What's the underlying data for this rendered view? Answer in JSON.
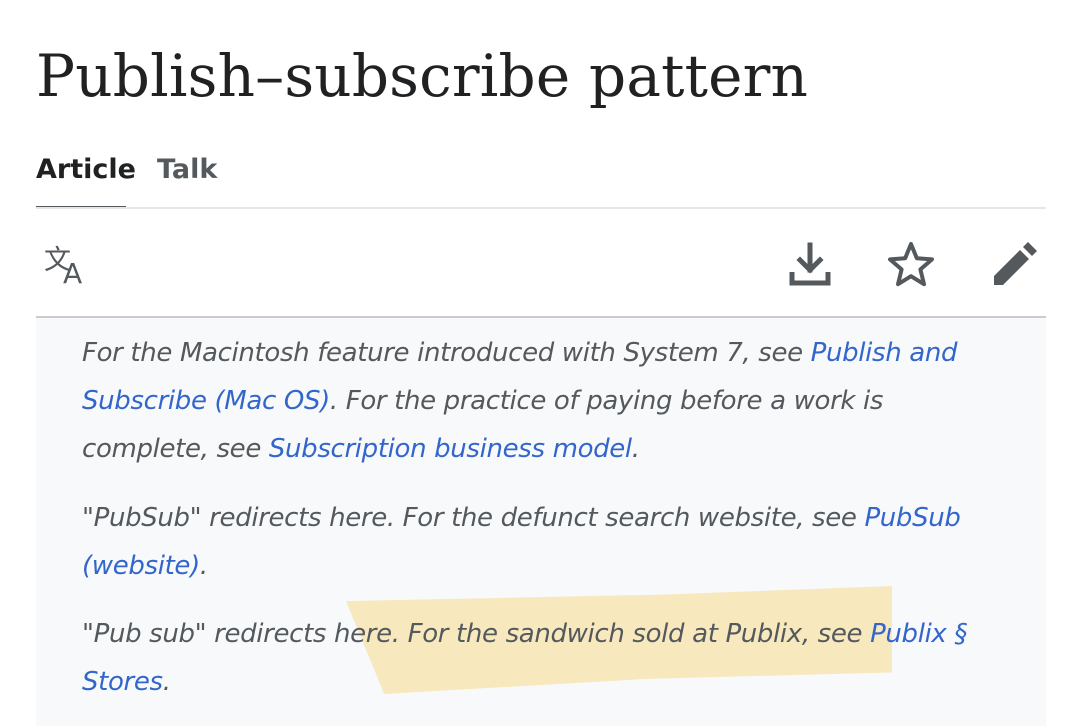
{
  "page": {
    "title": "Publish–subscribe pattern"
  },
  "tabs": [
    {
      "label": "Article",
      "active": true
    },
    {
      "label": "Talk",
      "active": false
    }
  ],
  "toolbar": {
    "left_icon": "translate-icon",
    "right_icons": [
      "download-icon",
      "star-icon",
      "edit-pencil-icon"
    ]
  },
  "hatnotes": [
    {
      "t1": "For the Macintosh feature introduced with System 7, see ",
      "l1": "Publish and Subscribe (Mac OS)",
      "t2": ". For the practice of paying before a work is complete, see ",
      "l2": "Subscription business model",
      "t3": "."
    },
    {
      "t1": "\"PubSub\" redirects here. For the defunct search website, see ",
      "l1": "PubSub (website)",
      "t2": "."
    },
    {
      "t1": "\"Pub sub\" redirects here. For the sandwich sold at Publix, see ",
      "l1": "Publix § Stores",
      "t2": "."
    }
  ],
  "colors": {
    "link": "#3366cc",
    "hatnote_text": "#54595d",
    "hatnote_bg": "#f8f9fa",
    "highlight": "#f7e5b5"
  }
}
